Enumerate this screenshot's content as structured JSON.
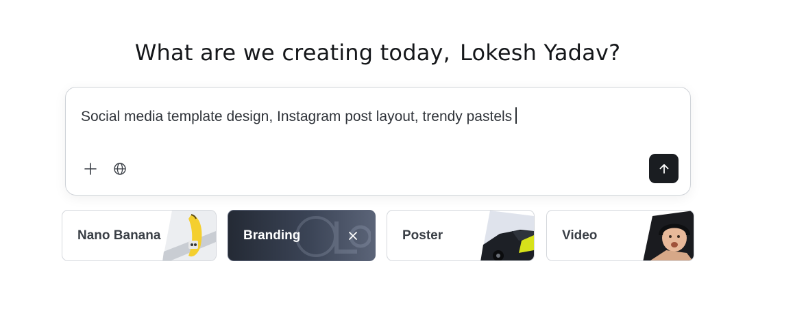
{
  "greeting": {
    "prefix": "What are we creating today,",
    "user_name": "Lokesh Yadav?"
  },
  "composer": {
    "prompt_value": "Social media template design, Instagram post layout, trendy pastels",
    "add_icon": "plus-icon",
    "web_icon": "globe-icon",
    "send_icon": "arrow-up-icon"
  },
  "modes": [
    {
      "label": "Nano Banana",
      "selected": false,
      "thumbnail": "banana-image"
    },
    {
      "label": "Branding",
      "selected": true,
      "thumbnail": "logo-mark"
    },
    {
      "label": "Poster",
      "selected": false,
      "thumbnail": "car-image"
    },
    {
      "label": "Video",
      "selected": false,
      "thumbnail": "baby-image"
    }
  ],
  "colors": {
    "accent_dark": "#1a1d21",
    "selected_card_start": "#242a35",
    "selected_card_end": "#5b6478"
  }
}
